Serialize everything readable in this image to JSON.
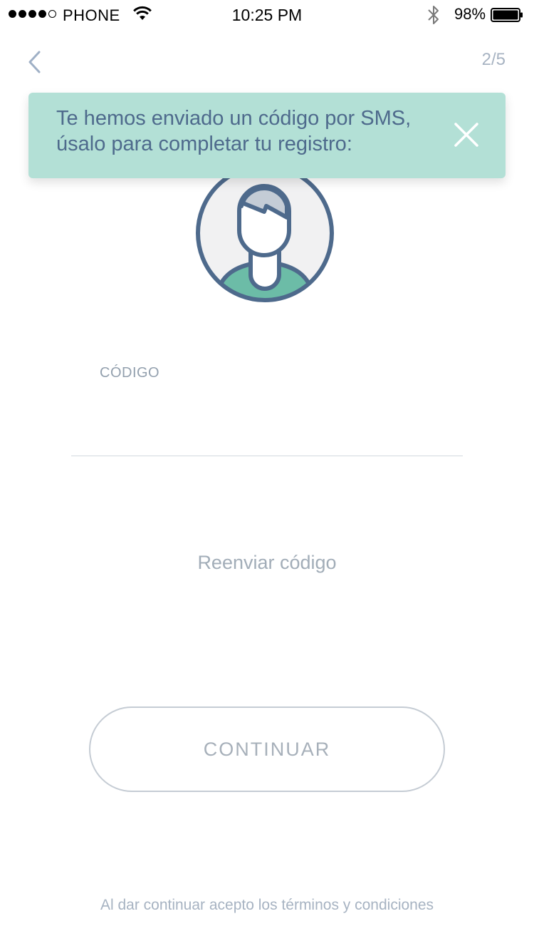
{
  "status_bar": {
    "carrier": "PHONE",
    "time": "10:25 PM",
    "battery_percent": "98%"
  },
  "nav": {
    "step": "2/5"
  },
  "toast": {
    "message": "Te hemos enviado un código por SMS, úsalo para completar tu registro:",
    "close_icon": "close-icon"
  },
  "form": {
    "code_label": "CÓDIGO",
    "code_value": "",
    "resend_label": "Reenviar código",
    "continue_label": "CONTINUAR"
  },
  "footer": {
    "terms": "Al dar continuar acepto los términos y condiciones"
  },
  "colors": {
    "toast_bg": "#b3e0d6",
    "primary_text": "#4e6a8c",
    "muted_text": "#a7b3c2",
    "avatar_shirt": "#6cbca7"
  }
}
